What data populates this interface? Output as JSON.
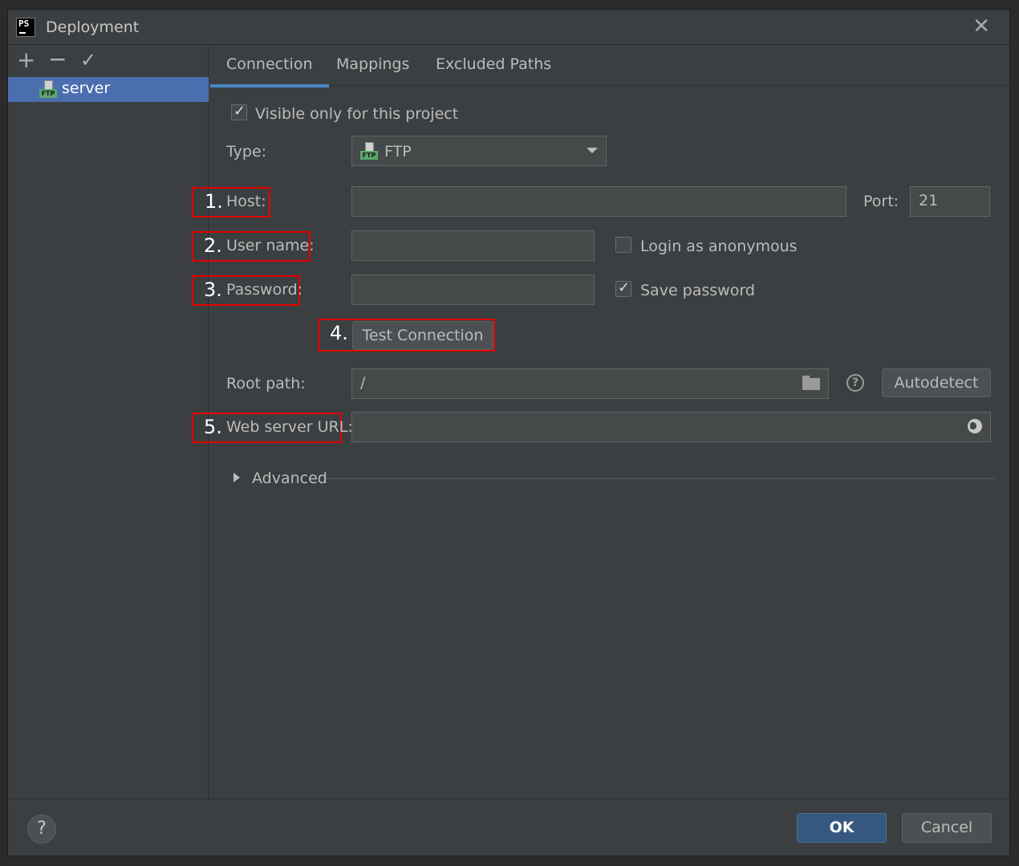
{
  "window": {
    "title": "Deployment"
  },
  "sidebar": {
    "tools": {
      "add": "+",
      "remove": "−",
      "apply": "✓"
    },
    "servers": [
      {
        "label": "server",
        "type_badge": "FTP"
      }
    ]
  },
  "tabs": [
    {
      "label": "Connection",
      "active": true
    },
    {
      "label": "Mappings",
      "active": false
    },
    {
      "label": "Excluded Paths",
      "active": false
    }
  ],
  "form": {
    "visible_only": {
      "label": "Visible only for this project",
      "checked": true
    },
    "type": {
      "label": "Type:",
      "value": "FTP",
      "badge": "FTP"
    },
    "host": {
      "label": "Host:",
      "value": ""
    },
    "port": {
      "label": "Port:",
      "value": "21"
    },
    "username": {
      "label": "User name:",
      "value": ""
    },
    "login_anonymous": {
      "label": "Login as anonymous",
      "checked": false
    },
    "password": {
      "label": "Password:",
      "value": ""
    },
    "save_password": {
      "label": "Save password",
      "checked": true
    },
    "test_connection": {
      "label": "Test Connection"
    },
    "root_path": {
      "label": "Root path:",
      "value": "/"
    },
    "autodetect": {
      "label": "Autodetect"
    },
    "web_server_url": {
      "label": "Web server URL:",
      "value": ""
    },
    "advanced": {
      "label": "Advanced"
    }
  },
  "annotations": [
    {
      "number": "1.",
      "target": "Host"
    },
    {
      "number": "2.",
      "target": "User name"
    },
    {
      "number": "3.",
      "target": "Password"
    },
    {
      "number": "4.",
      "target": "Test Connection"
    },
    {
      "number": "5.",
      "target": "Web server URL"
    }
  ],
  "footer": {
    "help": "?",
    "ok": "OK",
    "cancel": "Cancel"
  },
  "colors": {
    "background": "#3c3f41",
    "selection": "#4b6eaf",
    "tab_underline": "#4a88c7",
    "primary_button": "#365880",
    "annotation_border": "#e20000",
    "ftp_badge": "#59a869"
  },
  "icons": {
    "app": "phpstorm-logo-icon",
    "close": "close-icon",
    "server": "ftp-server-icon",
    "dropdown": "chevron-down-icon",
    "browse": "folder-icon",
    "web": "globe-icon",
    "help": "help-icon",
    "advanced": "triangle-right-icon"
  }
}
